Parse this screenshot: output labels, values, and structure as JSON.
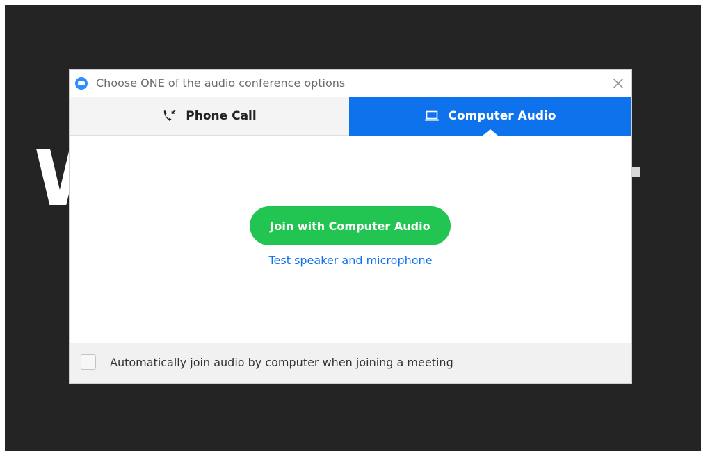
{
  "window": {
    "title": "Choose ONE of the audio conference options",
    "close_icon": "close-icon"
  },
  "tabs": [
    {
      "label": "Phone Call",
      "icon": "phone-call-icon",
      "selected": false
    },
    {
      "label": "Computer Audio",
      "icon": "laptop-icon",
      "selected": true
    }
  ],
  "main": {
    "join_button_label": "Join with Computer Audio",
    "test_link_label": "Test speaker and microphone"
  },
  "footer": {
    "auto_join_label": "Automatically join audio by computer when joining a meeting",
    "auto_join_checked": false
  },
  "colors": {
    "accent_blue": "#0e72ed",
    "join_green": "#23c552",
    "background_dark": "#242424"
  }
}
